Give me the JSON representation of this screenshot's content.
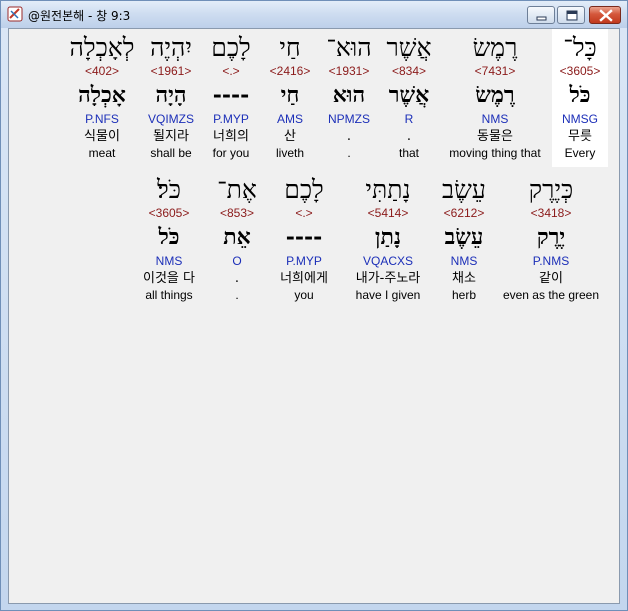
{
  "window": {
    "title": "@원전본해 - 창 9:3",
    "icons": {
      "app": "bible-app-icon",
      "minimize": "minimize-icon",
      "maximize": "maximize-icon",
      "close": "close-icon"
    },
    "colors": {
      "strongs": "#8b1a1a",
      "morph": "#1c2fb8",
      "highlight": "#ffffff"
    }
  },
  "rows": [
    {
      "words": [
        {
          "hebrew": "לְאָכְלָה",
          "strongs": "<402>",
          "lexeme": "אָכְלָה",
          "morph": "P.NFS",
          "korean": "식물이",
          "english": "meat"
        },
        {
          "hebrew": "יִהְיֶה",
          "strongs": "<1961>",
          "lexeme": "הָיָה",
          "morph": "VQIMZS",
          "korean": "될지라",
          "english": "shall be"
        },
        {
          "hebrew": "לָכֶם",
          "strongs": "<.>",
          "lexeme": "----",
          "morph": "P.MYP",
          "korean": "너희의",
          "english": "for you"
        },
        {
          "hebrew": "חַי",
          "strongs": "<2416>",
          "lexeme": "חַי",
          "morph": "AMS",
          "korean": "산",
          "english": "liveth"
        },
        {
          "hebrew": "הוּא־",
          "strongs": "<1931>",
          "lexeme": "הוּא",
          "morph": "NPMZS",
          "korean": ".",
          "english": "."
        },
        {
          "hebrew": "אֲשֶׁר",
          "strongs": "<834>",
          "lexeme": "אֲשֶׁר",
          "morph": "R",
          "korean": ".",
          "english": "that"
        },
        {
          "hebrew": "רֶמֶשׂ",
          "strongs": "<7431>",
          "lexeme": "רֶמֶשׂ",
          "morph": "NMS",
          "korean": "동물은",
          "english": "moving thing that"
        },
        {
          "hebrew": "כָּל־",
          "strongs": "<3605>",
          "lexeme": "כֹּל",
          "morph": "NMSG",
          "korean": "무릇",
          "english": "Every",
          "highlighted": true
        }
      ]
    },
    {
      "words": [
        {
          "hebrew": "כֹּל׃",
          "strongs": "<3605>",
          "lexeme": "כֹּל",
          "morph": "NMS",
          "korean": "이것을 다",
          "english": "all things"
        },
        {
          "hebrew": "אֶת־",
          "strongs": "<853>",
          "lexeme": "אֵת",
          "morph": "O",
          "korean": ".",
          "english": "."
        },
        {
          "hebrew": "לָכֶם",
          "strongs": "<.>",
          "lexeme": "----",
          "morph": "P.MYP",
          "korean": "너희에게",
          "english": "you"
        },
        {
          "hebrew": "נָתַתִּי",
          "strongs": "<5414>",
          "lexeme": "נָתַן",
          "morph": "VQACXS",
          "korean": "내가-주노라",
          "english": "have I given"
        },
        {
          "hebrew": "עֵשֶׂב",
          "strongs": "<6212>",
          "lexeme": "עֵשֶׂב",
          "morph": "NMS",
          "korean": "채소",
          "english": "herb"
        },
        {
          "hebrew": "כְּיֶרֶק",
          "strongs": "<3418>",
          "lexeme": "יֶרֶק",
          "morph": "P.NMS",
          "korean": "같이",
          "english": "even as the green"
        }
      ]
    }
  ]
}
